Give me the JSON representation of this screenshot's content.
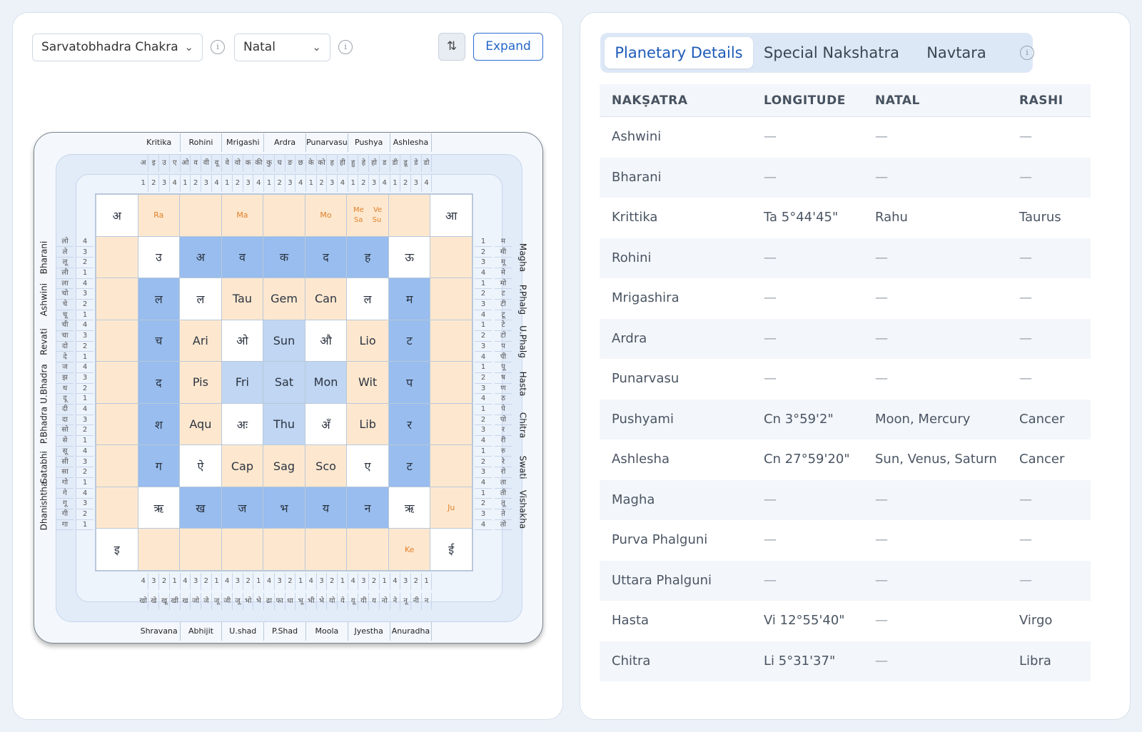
{
  "toolbar": {
    "chart_select": "Sarvatobhadra Chakra",
    "type_select": "Natal",
    "expand_label": "Expand",
    "info_glyph": "i",
    "settings_glyph": "⇅"
  },
  "chakra": {
    "top_nakshatras": [
      "Kritika",
      "Rohini",
      "Mrigashi",
      "Ardra",
      "Punarvasu",
      "Pushya",
      "Ashlesha"
    ],
    "bottom_nakshatras": [
      "Shravana",
      "Abhijit",
      "U.shad",
      "P.Shad",
      "Moola",
      "Jyestha",
      "Anuradha"
    ],
    "left_nakshatras": [
      "Bharani",
      "Ashwini",
      "Revati",
      "U.Bhadra",
      "P.Bhadra",
      "Satabhi",
      "Dhanishtha"
    ],
    "right_nakshatras": [
      "Magha",
      "P.Phalg",
      "U.Phalg",
      "Hasta",
      "Chitra",
      "Swati",
      "Vishakha"
    ],
    "top_letters": [
      "अ",
      "इ",
      "उ",
      "ए",
      "ओ",
      "व",
      "वी",
      "वू",
      "वे",
      "वो",
      "क",
      "की",
      "कु",
      "घ",
      "ङ",
      "छ",
      "के",
      "को",
      "ह",
      "ही",
      "हु",
      "हे",
      "हो",
      "ड",
      "डी",
      "डू",
      "डे",
      "डो"
    ],
    "bottom_letters": [
      "खो",
      "खे",
      "खू",
      "खी",
      "ख",
      "जो",
      "जे",
      "जू",
      "जी",
      "जू",
      "भो",
      "भे",
      "ढा",
      "फा",
      "धा",
      "भू",
      "भी",
      "भे",
      "यो",
      "ये",
      "यू",
      "यी",
      "य",
      "नो",
      "ने",
      "नू",
      "नी",
      "न"
    ],
    "top_padas": [
      "1",
      "2",
      "3",
      "4",
      "1",
      "2",
      "3",
      "4",
      "1",
      "2",
      "3",
      "4",
      "1",
      "2",
      "3",
      "4",
      "1",
      "2",
      "3",
      "4",
      "1",
      "2",
      "3",
      "4",
      "1",
      "2",
      "3",
      "4"
    ],
    "bottom_padas": [
      "4",
      "3",
      "2",
      "1",
      "4",
      "3",
      "2",
      "1",
      "4",
      "3",
      "2",
      "1",
      "4",
      "3",
      "2",
      "1",
      "4",
      "3",
      "2",
      "1",
      "4",
      "3",
      "2",
      "1",
      "4",
      "3",
      "2",
      "1"
    ],
    "left_letters": [
      "लो",
      "ले",
      "लू",
      "ली",
      "ला",
      "चो",
      "चे",
      "चू",
      "ची",
      "चा",
      "दो",
      "दे",
      "ज",
      "झ",
      "थ",
      "दू",
      "दी",
      "दा",
      "सो",
      "से",
      "सू",
      "सी",
      "सा",
      "गो",
      "गे",
      "गू",
      "गी",
      "गा"
    ],
    "left_padas": [
      "4",
      "3",
      "2",
      "1",
      "4",
      "3",
      "2",
      "1",
      "4",
      "3",
      "2",
      "1",
      "4",
      "3",
      "2",
      "1",
      "4",
      "3",
      "2",
      "1",
      "4",
      "3",
      "2",
      "1",
      "4",
      "3",
      "2",
      "1"
    ],
    "right_letters": [
      "म",
      "मी",
      "मू",
      "मे",
      "मो",
      "ट",
      "टी",
      "टू",
      "टे",
      "टो",
      "प",
      "पी",
      "पू",
      "ष",
      "ण",
      "ठ",
      "पे",
      "पो",
      "र",
      "री",
      "रु",
      "रे",
      "रो",
      "ता",
      "ती",
      "तू",
      "ते",
      "तो"
    ],
    "right_padas": [
      "1",
      "2",
      "3",
      "4",
      "1",
      "2",
      "3",
      "4",
      "1",
      "2",
      "3",
      "4",
      "1",
      "2",
      "3",
      "4",
      "1",
      "2",
      "3",
      "4",
      "1",
      "2",
      "3",
      "4",
      "1",
      "2",
      "3",
      "4"
    ],
    "grid": [
      [
        {
          "t": "अ",
          "c": "w"
        },
        {
          "t": "",
          "c": "o",
          "p": "Ra"
        },
        {
          "t": "",
          "c": "o"
        },
        {
          "t": "",
          "c": "o",
          "p": "Ma"
        },
        {
          "t": "",
          "c": "o"
        },
        {
          "t": "",
          "c": "o",
          "p": "Mo"
        },
        {
          "t": "",
          "c": "o",
          "p": "Me Ve Sa Su"
        },
        {
          "t": "",
          "c": "o"
        },
        {
          "t": "आ",
          "c": "w"
        }
      ],
      [
        {
          "t": "",
          "c": "o"
        },
        {
          "t": "उ",
          "c": "w"
        },
        {
          "t": "अ",
          "c": "b"
        },
        {
          "t": "व",
          "c": "b"
        },
        {
          "t": "क",
          "c": "b"
        },
        {
          "t": "द",
          "c": "b"
        },
        {
          "t": "ह",
          "c": "b"
        },
        {
          "t": "ऊ",
          "c": "w"
        },
        {
          "t": "",
          "c": "o"
        }
      ],
      [
        {
          "t": "",
          "c": "o"
        },
        {
          "t": "ल",
          "c": "b"
        },
        {
          "t": "ल",
          "c": "w"
        },
        {
          "t": "Tau",
          "c": "o"
        },
        {
          "t": "Gem",
          "c": "o"
        },
        {
          "t": "Can",
          "c": "o"
        },
        {
          "t": "ल",
          "c": "w"
        },
        {
          "t": "म",
          "c": "b"
        },
        {
          "t": "",
          "c": "o"
        }
      ],
      [
        {
          "t": "",
          "c": "o"
        },
        {
          "t": "च",
          "c": "b"
        },
        {
          "t": "Ari",
          "c": "o"
        },
        {
          "t": "ओ",
          "c": "w"
        },
        {
          "t": "Sun",
          "c": "lb"
        },
        {
          "t": "औ",
          "c": "w"
        },
        {
          "t": "Lio",
          "c": "o"
        },
        {
          "t": "ट",
          "c": "b"
        },
        {
          "t": "",
          "c": "o"
        }
      ],
      [
        {
          "t": "",
          "c": "o"
        },
        {
          "t": "द",
          "c": "b"
        },
        {
          "t": "Pis",
          "c": "o"
        },
        {
          "t": "Fri",
          "c": "lb"
        },
        {
          "t": "Sat",
          "c": "lb"
        },
        {
          "t": "Mon",
          "c": "lb"
        },
        {
          "t": "Wit",
          "c": "o"
        },
        {
          "t": "प",
          "c": "b"
        },
        {
          "t": "",
          "c": "o"
        }
      ],
      [
        {
          "t": "",
          "c": "o"
        },
        {
          "t": "श",
          "c": "b"
        },
        {
          "t": "Aqu",
          "c": "o"
        },
        {
          "t": "अः",
          "c": "w"
        },
        {
          "t": "Thu",
          "c": "lb"
        },
        {
          "t": "अँ",
          "c": "w"
        },
        {
          "t": "Lib",
          "c": "o"
        },
        {
          "t": "र",
          "c": "b"
        },
        {
          "t": "",
          "c": "o"
        }
      ],
      [
        {
          "t": "",
          "c": "o"
        },
        {
          "t": "ग",
          "c": "b"
        },
        {
          "t": "ऐ",
          "c": "w"
        },
        {
          "t": "Cap",
          "c": "o"
        },
        {
          "t": "Sag",
          "c": "o"
        },
        {
          "t": "Sco",
          "c": "o"
        },
        {
          "t": "ए",
          "c": "w"
        },
        {
          "t": "ट",
          "c": "b"
        },
        {
          "t": "",
          "c": "o"
        }
      ],
      [
        {
          "t": "",
          "c": "o"
        },
        {
          "t": "ऋ",
          "c": "w"
        },
        {
          "t": "ख",
          "c": "b"
        },
        {
          "t": "ज",
          "c": "b"
        },
        {
          "t": "भ",
          "c": "b"
        },
        {
          "t": "य",
          "c": "b"
        },
        {
          "t": "न",
          "c": "b"
        },
        {
          "t": "ऋ",
          "c": "w"
        },
        {
          "t": "",
          "c": "o",
          "p": "Ju"
        }
      ],
      [
        {
          "t": "इ",
          "c": "w"
        },
        {
          "t": "",
          "c": "o"
        },
        {
          "t": "",
          "c": "o"
        },
        {
          "t": "",
          "c": "o"
        },
        {
          "t": "",
          "c": "o"
        },
        {
          "t": "",
          "c": "o"
        },
        {
          "t": "",
          "c": "o"
        },
        {
          "t": "",
          "c": "o",
          "p": "Ke"
        },
        {
          "t": "ई",
          "c": "w"
        }
      ]
    ]
  },
  "tabs": [
    "Planetary Details",
    "Special Nakshatra",
    "Navtara"
  ],
  "table": {
    "headers": [
      "NAKṢATRA",
      "LONGITUDE",
      "NATAL",
      "RASHI"
    ],
    "rows": [
      [
        "Ashwini",
        "—",
        "—",
        "—"
      ],
      [
        "Bharani",
        "—",
        "—",
        "—"
      ],
      [
        "Krittika",
        "Ta 5°44'45\"",
        "Rahu",
        "Taurus"
      ],
      [
        "Rohini",
        "—",
        "—",
        "—"
      ],
      [
        "Mrigashira",
        "—",
        "—",
        "—"
      ],
      [
        "Ardra",
        "—",
        "—",
        "—"
      ],
      [
        "Punarvasu",
        "—",
        "—",
        "—"
      ],
      [
        "Pushyami",
        "Cn 3°59'2\"",
        "Moon, Mercury",
        "Cancer"
      ],
      [
        "Ashlesha",
        "Cn 27°59'20\"",
        "Sun, Venus, Saturn",
        "Cancer"
      ],
      [
        "Magha",
        "—",
        "—",
        "—"
      ],
      [
        "Purva Phalguni",
        "—",
        "—",
        "—"
      ],
      [
        "Uttara Phalguni",
        "—",
        "—",
        "—"
      ],
      [
        "Hasta",
        "Vi 12°55'40\"",
        "—",
        "Virgo"
      ],
      [
        "Chitra",
        "Li 5°31'37\"",
        "—",
        "Libra"
      ]
    ]
  }
}
